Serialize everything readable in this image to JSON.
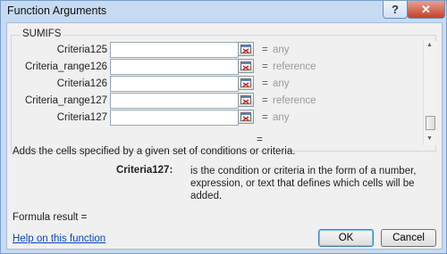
{
  "window": {
    "title": "Function Arguments",
    "help_glyph": "?",
    "close_glyph": "✕"
  },
  "group": {
    "title": "SUMIFS"
  },
  "args": [
    {
      "label": "Criteria125",
      "value": "",
      "hint": "any"
    },
    {
      "label": "Criteria_range126",
      "value": "",
      "hint": "reference"
    },
    {
      "label": "Criteria126",
      "value": "",
      "hint": "any"
    },
    {
      "label": "Criteria_range127",
      "value": "",
      "hint": "reference"
    },
    {
      "label": "Criteria127",
      "value": "",
      "hint": "any"
    }
  ],
  "equals": "=",
  "description": "Adds the cells specified by a given set of conditions or criteria.",
  "arg_help": {
    "name": "Criteria127:",
    "text": "is the condition or criteria in the form of a number, expression, or text that defines which cells will be added."
  },
  "formula_result": "Formula result =",
  "help_link": "Help on this function",
  "buttons": {
    "ok": "OK",
    "cancel": "Cancel"
  },
  "colors": {
    "link": "#0645c8",
    "hint": "#9a9a9a"
  }
}
